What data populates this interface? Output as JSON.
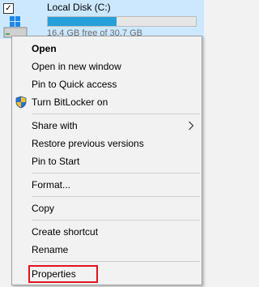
{
  "drive": {
    "name": "Local Disk (C:)",
    "space_text": "16.4 GB free of 30.7 GB",
    "used_fraction": 0.466,
    "bar_color": "#26a0da",
    "checked": true
  },
  "menu": {
    "open": "Open",
    "open_new_window": "Open in new window",
    "pin_quick_access": "Pin to Quick access",
    "bitlocker": "Turn BitLocker on",
    "share_with": "Share with",
    "restore_versions": "Restore previous versions",
    "pin_start": "Pin to Start",
    "format": "Format...",
    "copy": "Copy",
    "create_shortcut": "Create shortcut",
    "rename": "Rename",
    "properties": "Properties"
  },
  "icons": {
    "bitlocker": "shield-icon",
    "share_with": "chevron-right-icon",
    "drive": "drive-icon"
  },
  "highlight_color": "#e0141e"
}
